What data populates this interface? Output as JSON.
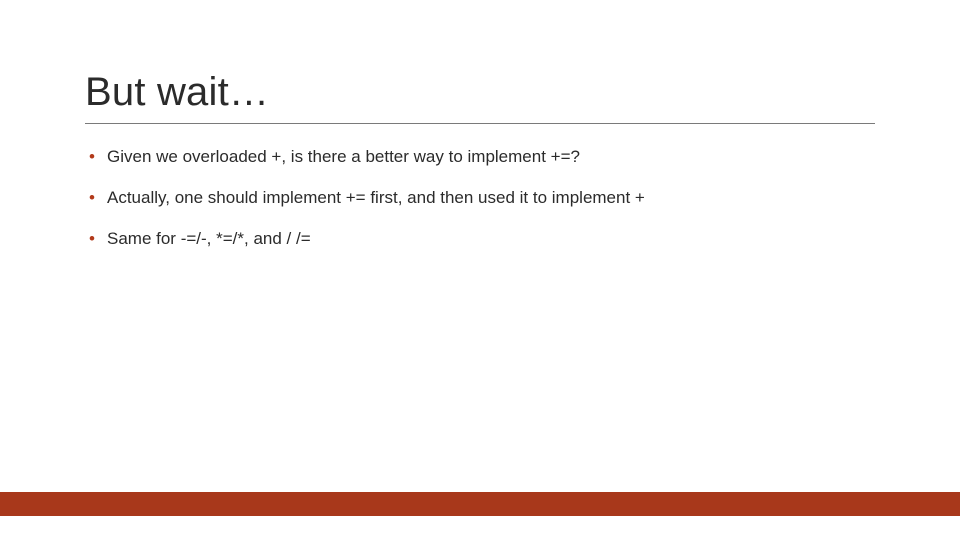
{
  "slide": {
    "title": "But wait…",
    "bullets": [
      "Given we overloaded +, is there a better way to implement +=?",
      "Actually, one should implement += first, and then used it to implement +",
      "Same for -=/-,  *=/*, and / /="
    ]
  },
  "colors": {
    "accent": "#a8381b",
    "bullet": "#b23a1a",
    "rule": "#7a7a7a",
    "text": "#2b2b2b"
  }
}
